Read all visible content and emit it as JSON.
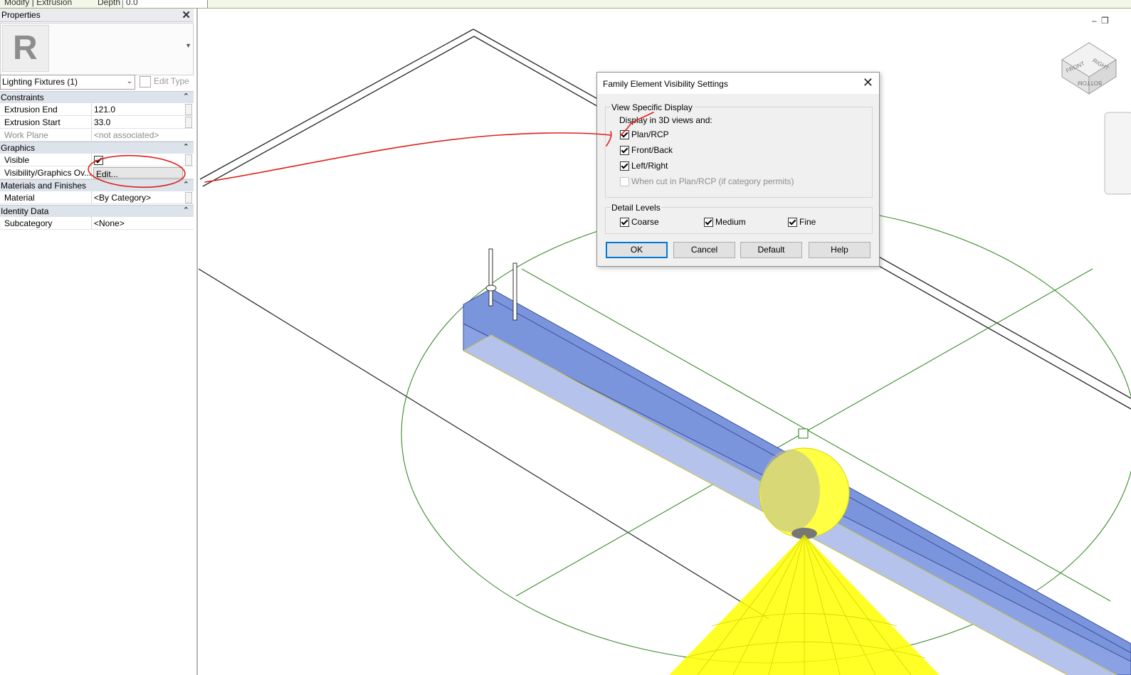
{
  "ribbon": {
    "context_label": "Modify | Extrusion",
    "depth_label": "Depth",
    "depth_value": "0.0"
  },
  "properties": {
    "title": "Properties",
    "logo_letter": "R",
    "type_selector": "Lighting Fixtures (1)",
    "edit_type_label": "Edit Type",
    "groups": {
      "constraints": "Constraints",
      "graphics": "Graphics",
      "materials": "Materials and Finishes",
      "identity": "Identity Data"
    },
    "rows": {
      "extrusion_end": {
        "label": "Extrusion End",
        "value": "121.0"
      },
      "extrusion_start": {
        "label": "Extrusion Start",
        "value": "33.0"
      },
      "work_plane": {
        "label": "Work Plane",
        "value": "<not associated>"
      },
      "visible": {
        "label": "Visible",
        "checked": true
      },
      "vis_graphics": {
        "label": "Visibility/Graphics Ov...",
        "button": "Edit..."
      },
      "material": {
        "label": "Material",
        "value": "<By Category>"
      },
      "subcategory": {
        "label": "Subcategory",
        "value": "<None>"
      }
    }
  },
  "viewcube": {
    "front": "FRONT",
    "right": "RIGHT",
    "bottom": "BOTTOM"
  },
  "dialog": {
    "title": "Family Element Visibility Settings",
    "view_specific_display": "View Specific Display",
    "display_in_3d": "Display in 3D views and:",
    "options": {
      "plan_rcp": "Plan/RCP",
      "front_back": "Front/Back",
      "left_right": "Left/Right",
      "when_cut": "When cut in Plan/RCP (if category permits)"
    },
    "detail_levels": "Detail Levels",
    "levels": {
      "coarse": "Coarse",
      "medium": "Medium",
      "fine": "Fine"
    },
    "buttons": {
      "ok": "OK",
      "cancel": "Cancel",
      "default": "Default",
      "help": "Help"
    }
  },
  "colors": {
    "annotation_red": "#e0201a",
    "fixture_blue": "#7b95dd",
    "light_yellow": "#ffff00",
    "guide_green": "#3a8a2a"
  }
}
